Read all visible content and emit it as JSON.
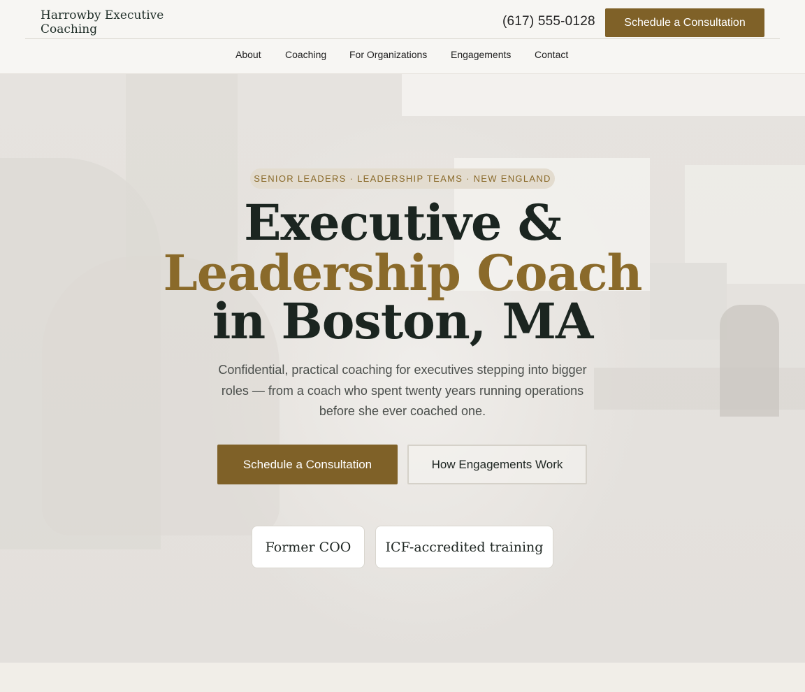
{
  "header": {
    "logo": "Harrowby Executive Coaching",
    "phone": "(617) 555-0128",
    "cta_label": "Schedule a Consultation",
    "nav": [
      "About",
      "Coaching",
      "For Organizations",
      "Engagements",
      "Contact"
    ]
  },
  "hero": {
    "eyebrow": "SENIOR LEADERS · LEADERSHIP TEAMS · NEW ENGLAND",
    "title_line1": "Executive &",
    "title_line2": "Leadership Coach",
    "title_line3": "in Boston, MA",
    "subtitle": "Confidential, practical coaching for executives stepping into bigger roles — from a coach who spent twenty years running operations before she ever coached one.",
    "primary_cta": "Schedule a Consultation",
    "secondary_cta": "How Engagements Work",
    "badges": [
      "Former COO",
      "ICF-accredited training"
    ]
  },
  "colors": {
    "accent": "#7f6128",
    "gold_text": "#8a6a2a",
    "heading": "#1b2520",
    "header_bg": "#f7f6f3"
  }
}
